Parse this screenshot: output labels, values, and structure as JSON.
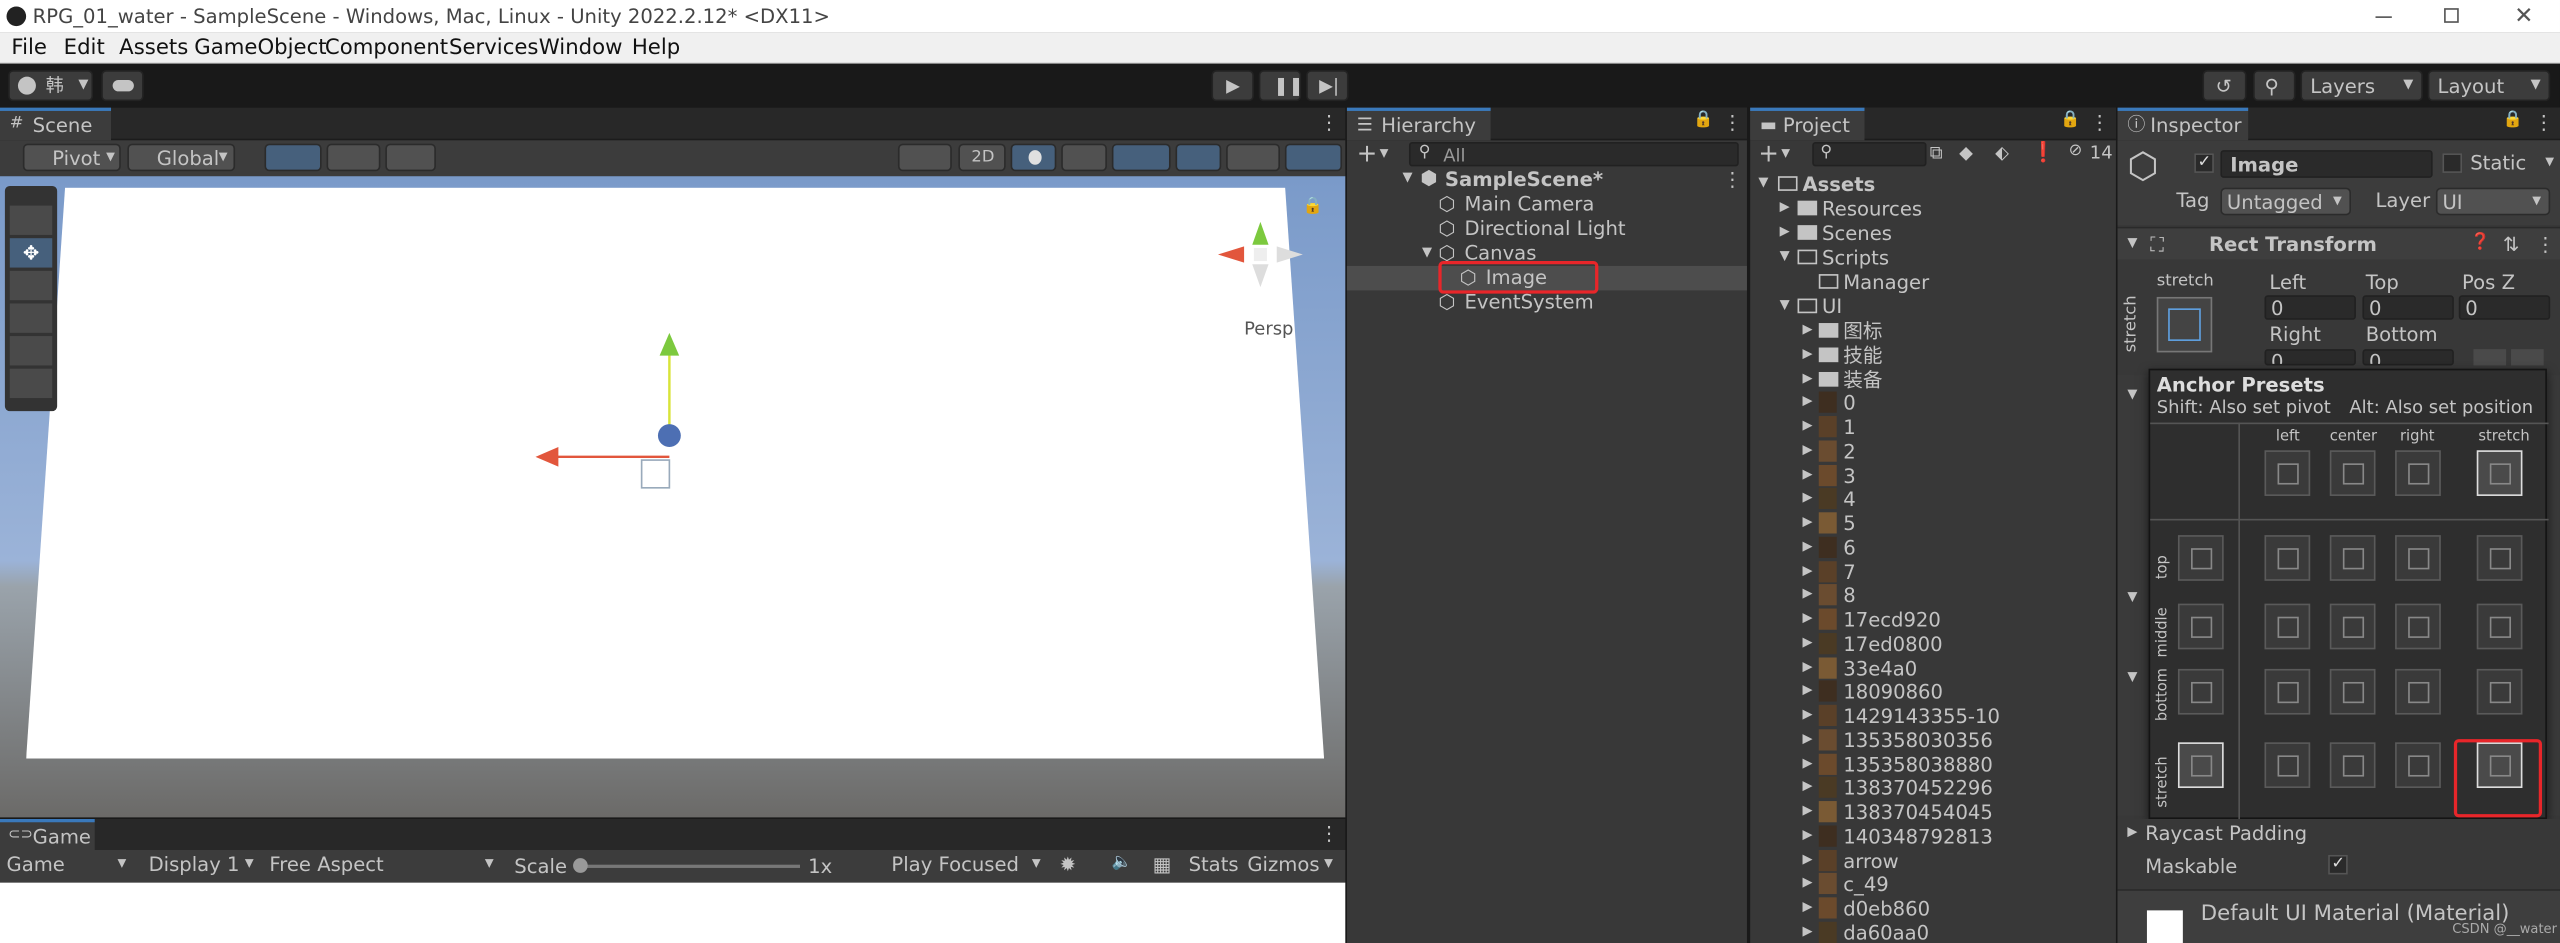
{
  "window": {
    "title": "RPG_01_water - SampleScene - Windows, Mac, Linux - Unity 2022.2.12* <DX11>"
  },
  "menu": [
    "File",
    "Edit",
    "Assets",
    "GameObject",
    "Component",
    "Services",
    "Window",
    "Help"
  ],
  "toolbar": {
    "account": "韩",
    "layers": "Layers",
    "layout": "Layout"
  },
  "scene": {
    "tab": "Scene",
    "pivot": "Pivot",
    "global": "Global",
    "mode2d": "2D",
    "persp": "Persp"
  },
  "game": {
    "tab": "Game",
    "view": "Game",
    "display": "Display 1",
    "aspect": "Free Aspect",
    "scale_label": "Scale",
    "scale_value": "1x",
    "play_mode": "Play Focused",
    "stats": "Stats",
    "gizmos": "Gizmos"
  },
  "hierarchy": {
    "tab": "Hierarchy",
    "search_placeholder": "All",
    "items": [
      {
        "label": "SampleScene*"
      },
      {
        "label": "Main Camera"
      },
      {
        "label": "Directional Light"
      },
      {
        "label": "Canvas"
      },
      {
        "label": "Image"
      },
      {
        "label": "EventSystem"
      }
    ]
  },
  "project": {
    "tab": "Project",
    "badge": "14",
    "root": "Assets",
    "folders": [
      "Resources",
      "Scenes",
      "Scripts"
    ],
    "scripts_child": "Manager",
    "ui": "UI",
    "ui_folders": [
      "图标",
      "技能",
      "装备"
    ],
    "ui_items": [
      "0",
      "1",
      "2",
      "3",
      "4",
      "5",
      "6",
      "7",
      "8",
      "17ecd920",
      "17ed0800",
      "33e4a0",
      "18090860",
      "1429143355-10",
      "135358030356",
      "135358038880",
      "138370452296",
      "138370454045",
      "140348792813",
      "arrow",
      "c_49",
      "d0eb860",
      "da60aa0"
    ]
  },
  "inspector": {
    "tab": "Inspector",
    "name": "Image",
    "static": "Static",
    "tag_label": "Tag",
    "tag": "Untagged",
    "layer_label": "Layer",
    "layer": "UI",
    "rect_transform": "Rect Transform",
    "stretch": "stretch",
    "left_label": "Left",
    "top_label": "Top",
    "posz_label": "Pos Z",
    "left": "0",
    "top": "0",
    "posz": "0",
    "right_label": "Right",
    "bottom_label": "Bottom",
    "right": "0",
    "bottom": "0",
    "raycast_padding": "Raycast Padding",
    "maskable": "Maskable",
    "material": "Default UI Material (Material)",
    "watermark": "CSDN @__water"
  },
  "anchor_presets": {
    "title": "Anchor Presets",
    "hint_shift": "Shift: Also set pivot",
    "hint_alt": "Alt: Also set position",
    "cols": [
      "left",
      "center",
      "right",
      "stretch"
    ],
    "rows": [
      "top",
      "middle",
      "bottom",
      "stretch"
    ]
  }
}
